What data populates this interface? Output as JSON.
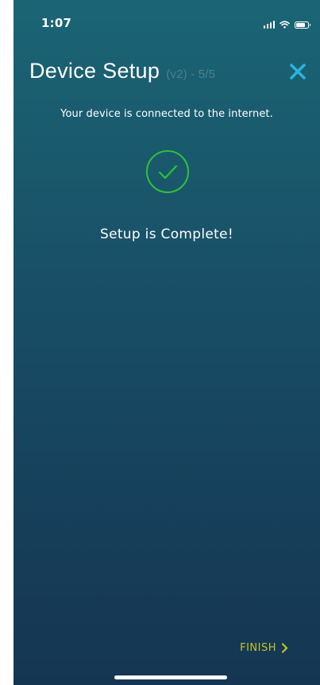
{
  "status_bar": {
    "time": "1:07"
  },
  "header": {
    "title": "Device Setup",
    "subtitle": "(v2) - 5/5"
  },
  "message": {
    "connected": "Your device is connected to the internet.",
    "complete": "Setup is Complete!"
  },
  "footer": {
    "finish_label": "FINISH"
  },
  "colors": {
    "accent_close": "#2bb3dd",
    "success_green": "#2fc23a",
    "finish_yellow": "#c6c422",
    "bg_top": "#1a6575",
    "bg_bottom": "#153653"
  },
  "icons": {
    "close": "close-icon",
    "check": "checkmark-circle-icon",
    "chevron": "chevron-right-icon",
    "signal": "cellular-signal-icon",
    "wifi": "wifi-icon",
    "battery": "battery-icon"
  }
}
